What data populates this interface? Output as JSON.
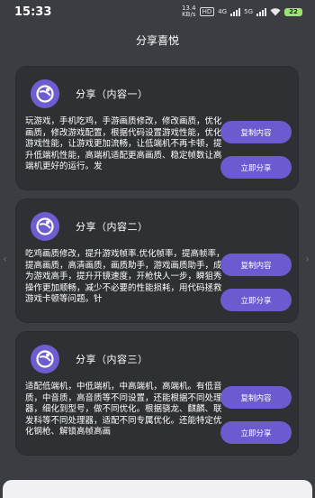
{
  "status": {
    "time": "15:33",
    "speed_top": "13.4",
    "speed_bottom": "KB/s",
    "hd": "HD",
    "net1": "4G",
    "net2": "5G",
    "battery": "22"
  },
  "header": {
    "title": "分享喜悦"
  },
  "cards": [
    {
      "title": "分享（内容一）",
      "text": "玩游戏，手机吃鸡，手游画质修改，修改画质，优化画质，修改游戏配置，根据代码设置游戏性能，优化游戏性能，让游戏更加流畅，让低端机不再卡顿，提升低端机性能，高端机适配更高画质、稳定帧数让高端机更好的运行。发",
      "copy_label": "复制内容",
      "share_label": "立即分享"
    },
    {
      "title": "分享（内容二）",
      "text": "吃鸡画质修改，提升游戏帧率.优化帧率，提高帧率，提高画质，高清画质，画质助手，游戏画质助手，成为游戏高手，提升开镜速度，开枪快人一步，瞬狙秀操作更加顺畅，减少不必要的性能损耗，用代码拯救游戏卡顿等问题。针",
      "copy_label": "复制内容",
      "share_label": "立即分享"
    },
    {
      "title": "分享（内容三）",
      "text": "适配低端机，中低端机，中高端机，高端机。有低音质，中音质，高音质等不同设置，还能根据不同处理器，细化到型号，做不同优化。根据骁龙、麒麟、联发科等不同处理器，适配不同专属优化。还能特定优化钢枪、解锁高帧高画",
      "copy_label": "复制内容",
      "share_label": "立即分享"
    }
  ],
  "side": {
    "left_arrow": "‹",
    "right_arrow": "›"
  }
}
